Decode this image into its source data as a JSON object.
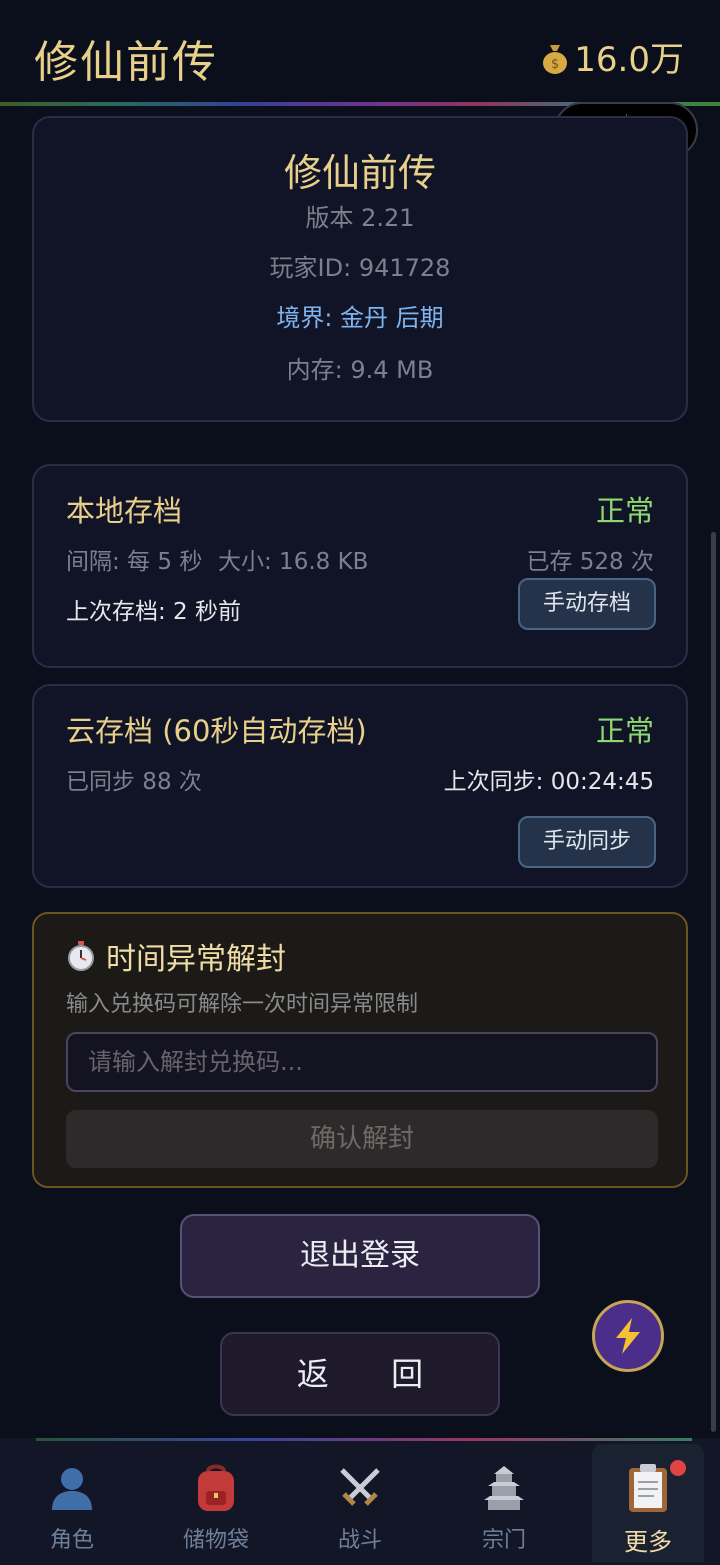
{
  "header": {
    "title": "修仙前传",
    "coins": "16.0万",
    "coin_icon": "money-bag-icon"
  },
  "info": {
    "title": "修仙前传",
    "version": "版本 2.21",
    "player_id": "玩家ID: 941728",
    "realm": "境界: 金丹 后期",
    "memory": "内存: 9.4 MB",
    "realm_color": "#7fb4ee"
  },
  "local_save": {
    "title": "本地存档",
    "status": "正常",
    "interval": "间隔: 每 5 秒",
    "size": "大小: 16.8 KB",
    "saved_count": "已存 528 次",
    "last_save": "上次存档: 2 秒前",
    "button": "手动存档"
  },
  "cloud_save": {
    "title": "云存档 (60秒自动存档)",
    "status": "正常",
    "synced_count": "已同步 88 次",
    "last_sync": "上次同步: 00:24:45",
    "button": "手动同步"
  },
  "unlock": {
    "title": "时间异常解封",
    "icon": "stopwatch-icon",
    "description": "输入兑换码可解除一次时间异常限制",
    "placeholder": "请输入解封兑换码...",
    "value": "",
    "button": "确认解封"
  },
  "actions": {
    "logout": "退出登录",
    "back": "返 回"
  },
  "tabs": [
    {
      "label": "角色",
      "icon": "character-icon"
    },
    {
      "label": "储物袋",
      "icon": "backpack-icon"
    },
    {
      "label": "战斗",
      "icon": "crossed-swords-icon"
    },
    {
      "label": "宗门",
      "icon": "sect-pagoda-icon"
    },
    {
      "label": "更多",
      "icon": "clipboard-icon",
      "active": true
    }
  ],
  "colors": {
    "accent_gold": "#e8cf8a",
    "status_green": "#8fd870",
    "background": "#0b0f1c"
  }
}
